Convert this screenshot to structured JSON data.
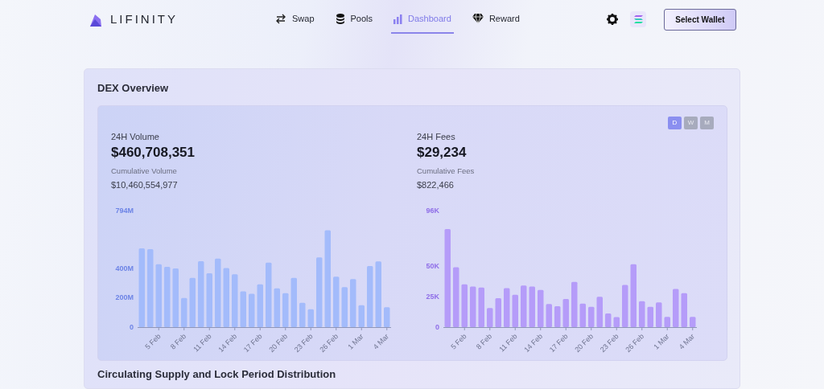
{
  "header": {
    "logo_text": "LIFINITY",
    "nav": [
      {
        "label": "Swap",
        "selected": false
      },
      {
        "label": "Pools",
        "selected": false
      },
      {
        "label": "Dashboard",
        "selected": true
      },
      {
        "label": "Reward",
        "selected": false
      }
    ],
    "wallet_button": "Select Wallet"
  },
  "dex_overview": {
    "title": "DEX Overview",
    "period_buttons": [
      {
        "label": "D",
        "selected": true
      },
      {
        "label": "W",
        "selected": false
      },
      {
        "label": "M",
        "selected": false
      }
    ],
    "panels": [
      {
        "label": "24H Volume",
        "value": "$460,708,351",
        "cumulative_label": "Cumulative Volume",
        "cumulative_value": "$10,460,554,977",
        "chart_data": {
          "type": "bar",
          "categories": [
            null,
            null,
            "5 Feb",
            null,
            null,
            "8 Feb",
            null,
            null,
            "11 Feb",
            null,
            null,
            "14 Feb",
            null,
            null,
            "17 Feb",
            null,
            null,
            "20 Feb",
            null,
            null,
            "23 Feb",
            null,
            null,
            "26 Feb",
            null,
            null,
            "1 Mar",
            null,
            null,
            "4 Mar"
          ],
          "series": [
            {
              "color": "#a3bbfb",
              "values": [
                536000000,
                531000000,
                429000000,
                411000000,
                400000000,
                198000000,
                335000000,
                449000000,
                367000000,
                467000000,
                402000000,
                360000000,
                244000000,
                227000000,
                291000000,
                440000000,
                264000000,
                231000000,
                335000000,
                165000000,
                122000000,
                475000000,
                660000000,
                344000000,
                273000000,
                327000000,
                149000000,
                416000000,
                447000000,
                136000000
              ]
            }
          ],
          "ylim": [
            0,
            794000000
          ],
          "yticks": [
            {
              "value": 0,
              "label": "0"
            },
            {
              "value": 200000000,
              "label": "200M"
            },
            {
              "value": 400000000,
              "label": "400M"
            },
            {
              "value": 794000000,
              "label": "794M"
            }
          ]
        }
      },
      {
        "label": "24H Fees",
        "value": "$29,234",
        "cumulative_label": "Cumulative Fees",
        "cumulative_value": "$822,466",
        "chart_data": {
          "type": "bar",
          "categories": [
            null,
            null,
            "5 Feb",
            null,
            null,
            "8 Feb",
            null,
            null,
            "11 Feb",
            null,
            null,
            "14 Feb",
            null,
            null,
            "17 Feb",
            null,
            null,
            "20 Feb",
            null,
            null,
            "23 Feb",
            null,
            null,
            "26 Feb",
            null,
            null,
            "1 Mar",
            null,
            null,
            "4 Mar"
          ],
          "series": [
            {
              "color": "#b59cf9",
              "values": [
                80800,
                49300,
                35300,
                33500,
                32600,
                15800,
                23900,
                32100,
                26600,
                34200,
                33500,
                30600,
                19000,
                17200,
                23200,
                37300,
                19400,
                16700,
                25000,
                11200,
                8300,
                34800,
                51800,
                21400,
                16700,
                20300,
                8500,
                31500,
                27900,
                8500
              ]
            }
          ],
          "ylim": [
            0,
            96000
          ],
          "yticks": [
            {
              "value": 0,
              "label": "0"
            },
            {
              "value": 25000,
              "label": "25K"
            },
            {
              "value": 50000,
              "label": "50K"
            },
            {
              "value": 96000,
              "label": "96K"
            }
          ]
        }
      }
    ]
  },
  "next_section_title": "Circulating Supply and Lock Period Distribution"
}
